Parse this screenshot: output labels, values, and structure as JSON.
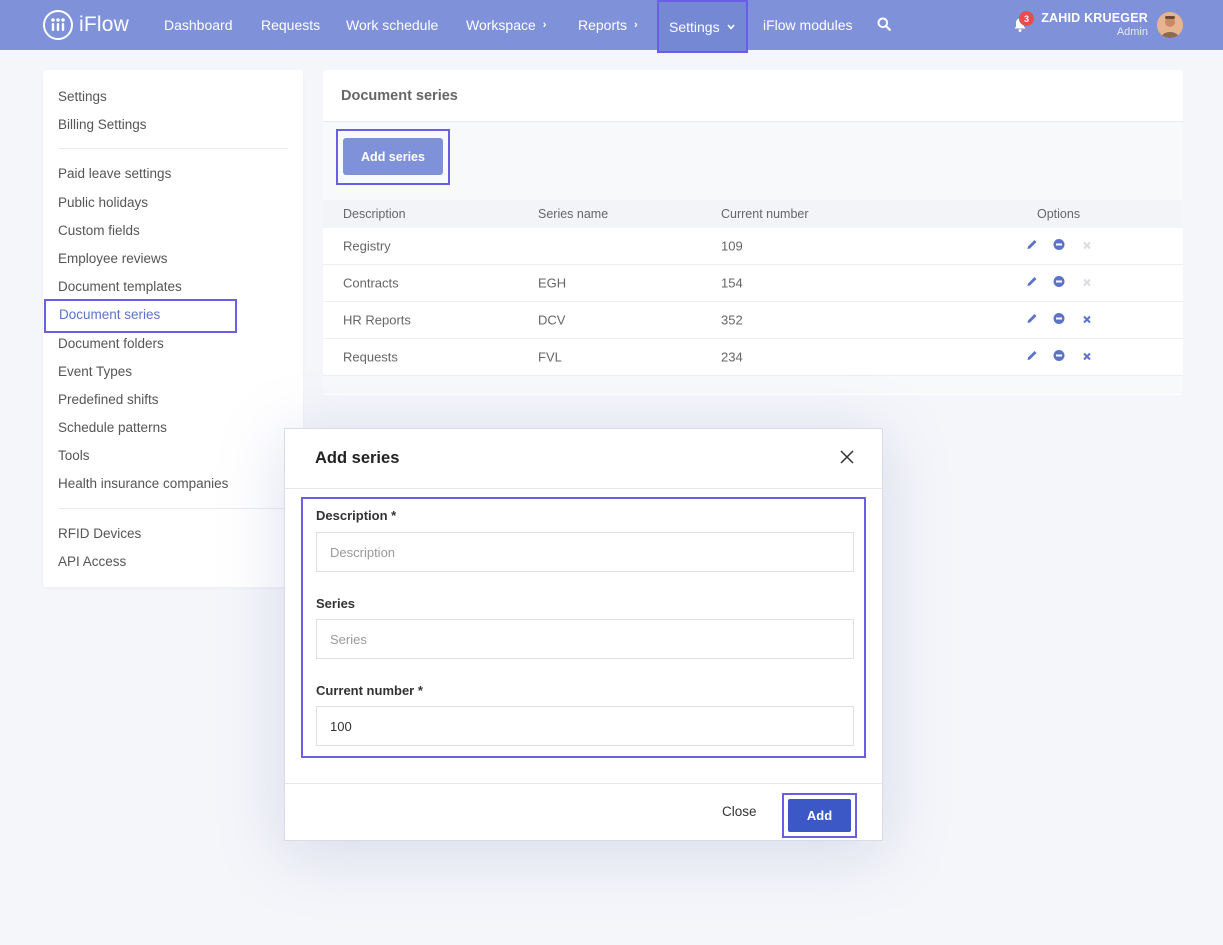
{
  "app": {
    "logo_text": "iFlow"
  },
  "nav": {
    "items": [
      {
        "label": "Dashboard"
      },
      {
        "label": "Requests"
      },
      {
        "label": "Work schedule"
      },
      {
        "label": "Workspace"
      },
      {
        "label": "Reports"
      },
      {
        "label": "Settings"
      },
      {
        "label": "iFlow modules"
      }
    ],
    "notification_count": "3",
    "user_name": "ZAHID KRUEGER",
    "user_role": "Admin"
  },
  "sidebar": {
    "group1": [
      "Settings",
      "Billing Settings"
    ],
    "group2": [
      "Paid leave settings",
      "Public holidays",
      "Custom fields",
      "Employee reviews",
      "Document templates",
      "Document series",
      "Document folders",
      "Event Types",
      "Predefined shifts",
      "Schedule patterns",
      "Tools",
      "Health insurance companies"
    ],
    "group3": [
      "RFID Devices",
      "API Access"
    ],
    "active": "Document series"
  },
  "main": {
    "title": "Document series",
    "add_button": "Add series",
    "columns": [
      "Description",
      "Series name",
      "Current number",
      "Options"
    ],
    "rows": [
      {
        "description": "Registry",
        "series": "",
        "number": "109",
        "deletable": false
      },
      {
        "description": "Contracts",
        "series": "EGH",
        "number": "154",
        "deletable": false
      },
      {
        "description": "HR Reports",
        "series": "DCV",
        "number": "352",
        "deletable": true
      },
      {
        "description": "Requests",
        "series": "FVL",
        "number": "234",
        "deletable": true
      }
    ]
  },
  "modal": {
    "title": "Add series",
    "description_label": "Description *",
    "description_placeholder": "Description",
    "series_label": "Series",
    "series_placeholder": "Series",
    "number_label": "Current number *",
    "number_value": "100",
    "close_label": "Close",
    "add_label": "Add"
  },
  "colors": {
    "nav_bg": "#7f91d8",
    "highlight_border": "#6a5ee6",
    "primary_button": "#3b58c6",
    "badge": "#e94c4c",
    "icon_blue": "#5d73c9"
  }
}
